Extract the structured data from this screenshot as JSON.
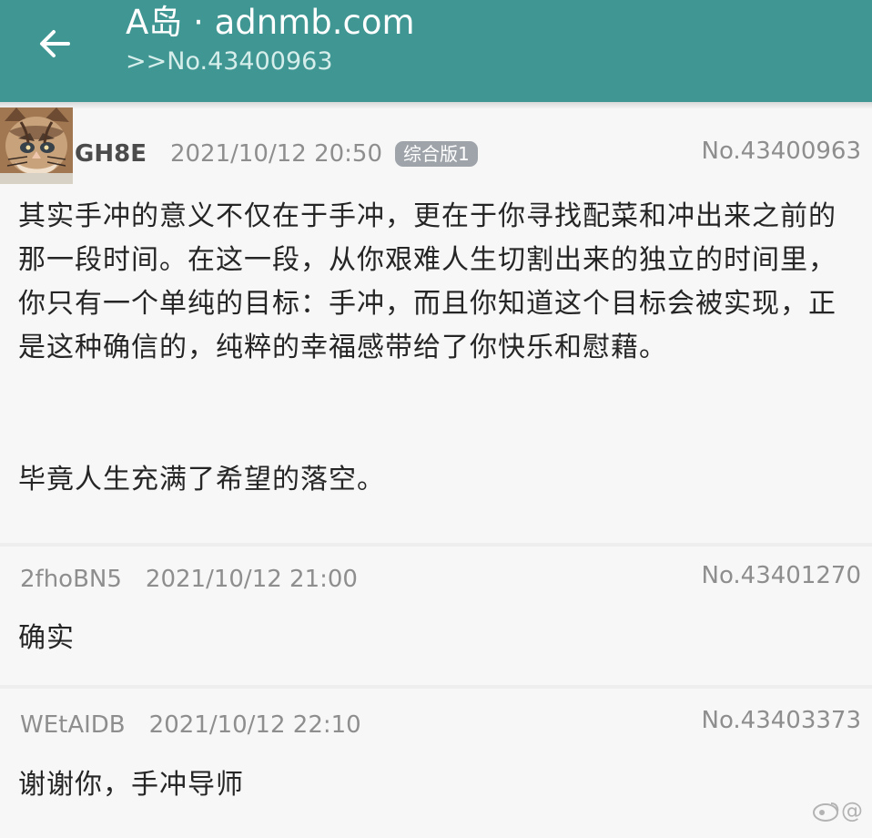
{
  "header": {
    "back_icon": "back-arrow-icon",
    "title": "A岛 · adnmb.com",
    "subtitle": ">>No.43400963",
    "background": "#3f9692"
  },
  "posts": [
    {
      "avatar": "cat-avatar",
      "user": "GH8E",
      "time": "2021/10/12 20:50",
      "board": "综合版1",
      "number": "No.43400963",
      "content": "其实手冲的意义不仅在于手冲，更在于你寻找配菜和冲出来之前的那一段时间。在这一段，从你艰难人生切割出来的独立的时间里，你只有一个单纯的目标：手冲，而且你知道这个目标会被实现，正是这种确信的，纯粹的幸福感带给了你快乐和慰藉。",
      "content_2": "毕竟人生充满了希望的落空。"
    },
    {
      "user": "2fhoBN5",
      "time": "2021/10/12 21:00",
      "number": "No.43401270",
      "content": "确实"
    },
    {
      "user": "WEtAIDB",
      "time": "2021/10/12 22:10",
      "number": "No.43403373",
      "content": "谢谢你，手冲导师"
    }
  ],
  "watermark": {
    "icon": "weibo-icon",
    "text": "@"
  }
}
